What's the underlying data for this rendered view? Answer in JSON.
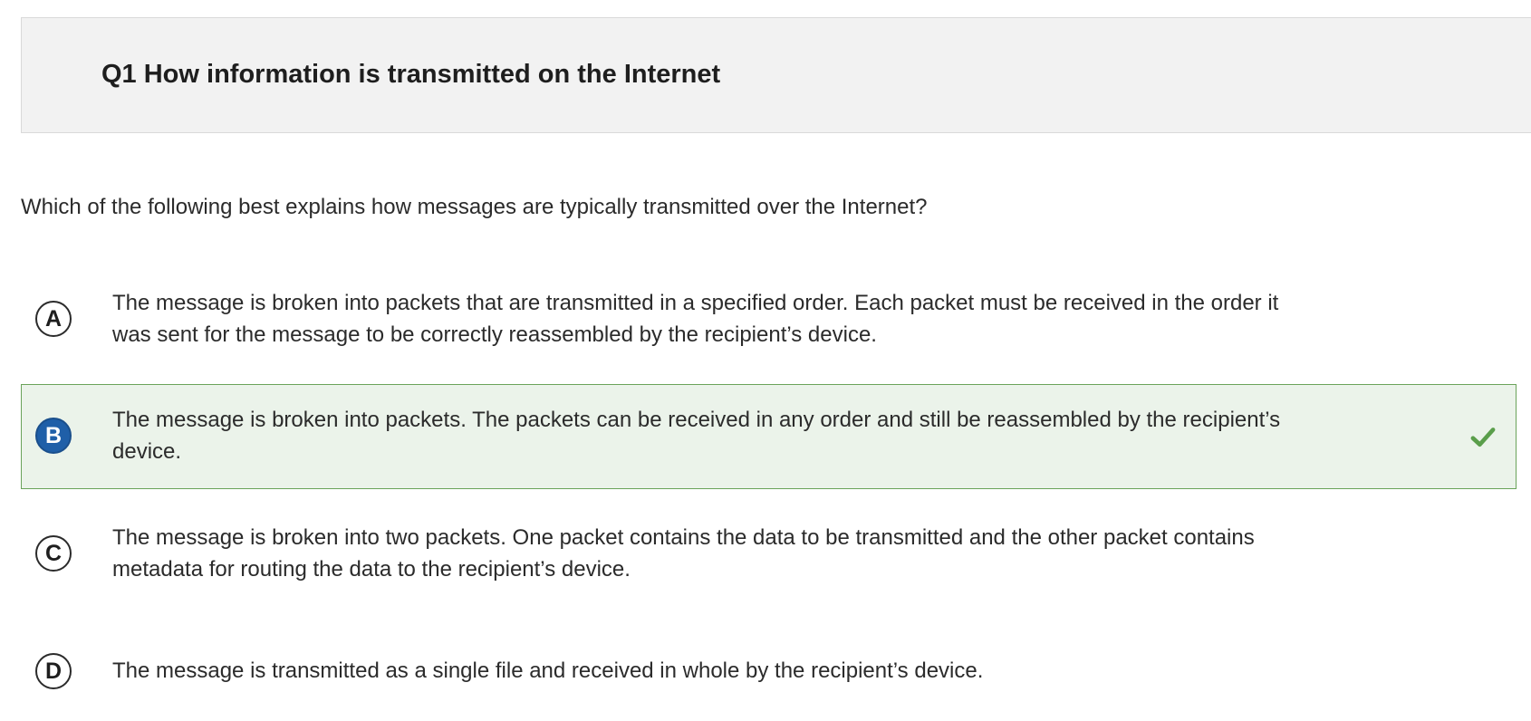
{
  "question": {
    "title": "Q1 How information is transmitted on the Internet",
    "prompt": "Which of the following best explains how messages are typically transmitted over the Internet?"
  },
  "choices": [
    {
      "letter": "A",
      "text": "The message is broken into packets that are transmitted in a specified order. Each packet must be received in the order it was sent for the message to be correctly reassembled by the recipient’s device.",
      "selected": false
    },
    {
      "letter": "B",
      "text": "The message is broken into packets. The packets can be received in any order and still be reassembled by the recipient’s device.",
      "selected": true,
      "correct": true
    },
    {
      "letter": "C",
      "text": "The message is broken into two packets. One packet contains the data to be transmitted and the other packet contains metadata for routing the data to the recipient’s device.",
      "selected": false
    },
    {
      "letter": "D",
      "text": "The message is transmitted as a single file and received in whole by the recipient’s device.",
      "selected": false
    }
  ],
  "icons": {
    "correct_indicator": "checkmark-icon"
  },
  "colors": {
    "header_background": "#f2f2f2",
    "selected_background": "#ebf3ea",
    "selected_border": "#6aa35a",
    "selected_letter_fill": "#1f5fa8",
    "check_color": "#5a9e4b"
  }
}
